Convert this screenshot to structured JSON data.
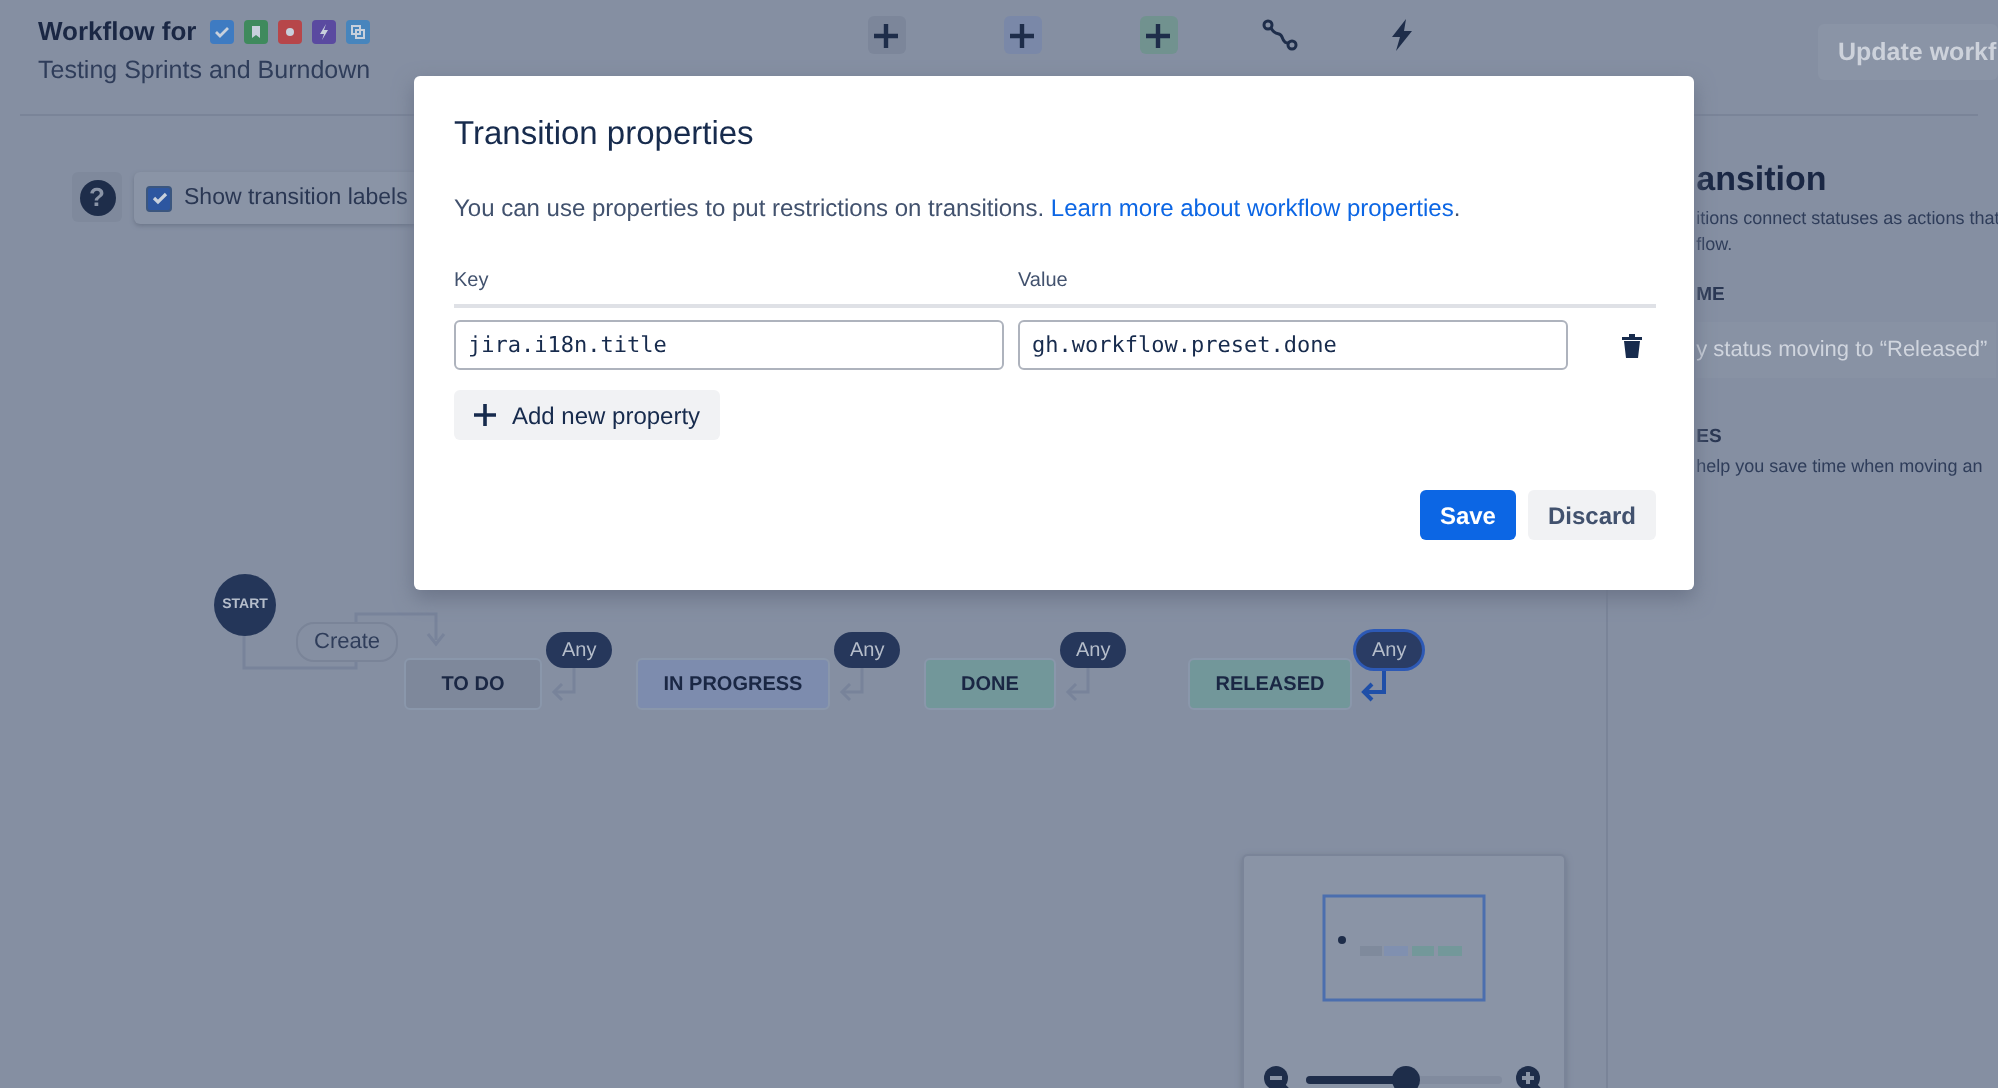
{
  "header": {
    "title": "Workflow for",
    "subtitle": "Testing Sprints and Burndown",
    "project_icons": [
      {
        "kind": "check",
        "color": "#3e7bc2"
      },
      {
        "kind": "bookmark",
        "color": "#3f8a5d"
      },
      {
        "kind": "dot",
        "color": "#b7464a"
      },
      {
        "kind": "bolt",
        "color": "#5a4aa0"
      },
      {
        "kind": "copy",
        "color": "#4785bd"
      }
    ]
  },
  "toolbar": [
    {
      "kind": "add",
      "color": "#7c869a"
    },
    {
      "kind": "add",
      "color": "#7a88a8"
    },
    {
      "kind": "add",
      "color": "#71928f"
    },
    {
      "kind": "transition"
    },
    {
      "kind": "rule"
    }
  ],
  "update_button": {
    "label": "Update workf"
  },
  "canvas_controls": {
    "help": "?",
    "show_transition_labels": {
      "label": "Show transition labels",
      "checked": true
    }
  },
  "diagram": {
    "start": "START",
    "create_transition": "Create",
    "statuses": [
      {
        "name": "TO DO",
        "color": "#7e889b",
        "any": "Any",
        "selected": false
      },
      {
        "name": "IN PROGRESS",
        "color": "#7d8cae",
        "any": "Any",
        "selected": false
      },
      {
        "name": "DONE",
        "color": "#72979a",
        "any": "Any",
        "selected": false
      },
      {
        "name": "RELEASED",
        "color": "#72979a",
        "any": "Any",
        "selected": true
      }
    ]
  },
  "minimap": {
    "level": 0.51
  },
  "side_panel": {
    "title": "ansition",
    "description": [
      "itions connect statuses as actions that",
      "flow."
    ],
    "name_label": "ME",
    "name_placeholder": "y status moving to “Released”",
    "properties_label": "ES",
    "properties_text": "help you save time when moving an"
  },
  "modal": {
    "title": "Transition properties",
    "description": "You can use properties to put restrictions on transitions.",
    "link": "Learn more about workflow properties",
    "after_link": ".",
    "columns": [
      "Key",
      "Value"
    ],
    "properties": [
      {
        "key": "jira.i18n.title",
        "value": "gh.workflow.preset.done"
      }
    ],
    "add_button": "Add new property",
    "buttons": [
      {
        "label": "Save",
        "kind": "primary"
      },
      {
        "label": "Discard",
        "kind": "secondary"
      }
    ]
  }
}
